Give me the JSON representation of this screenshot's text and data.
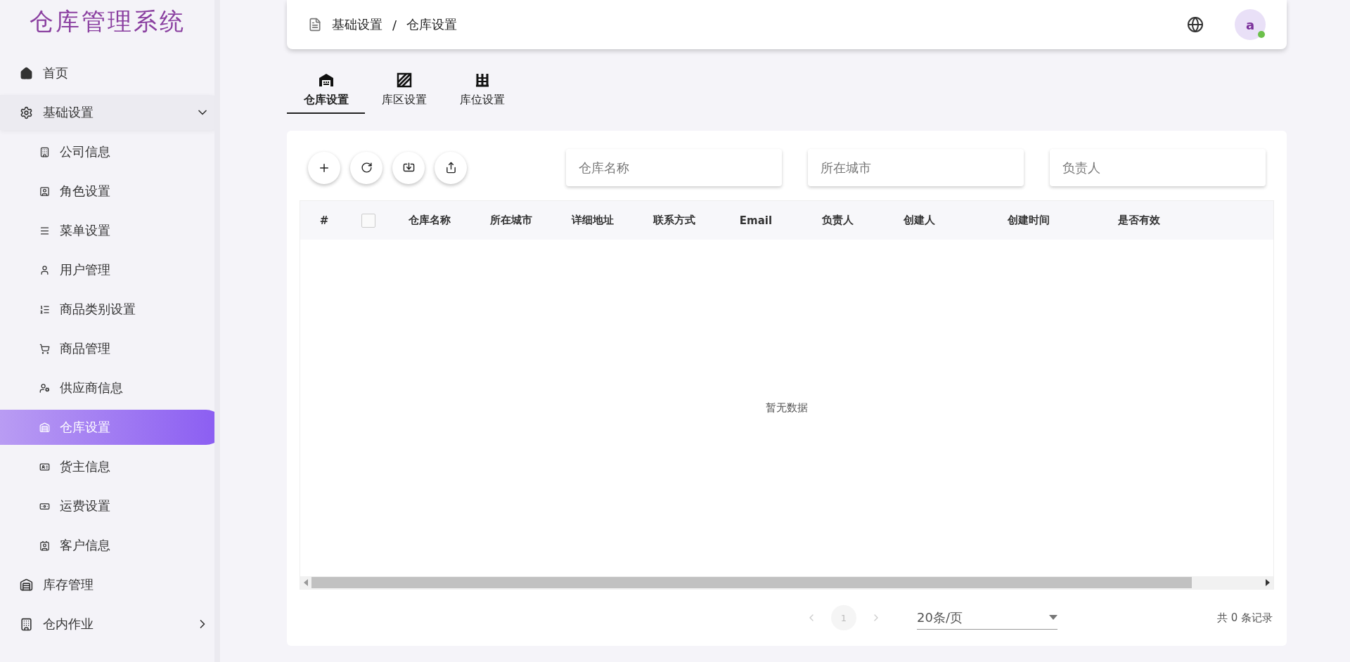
{
  "app_title": "仓库管理系统",
  "sidebar": {
    "items": [
      {
        "label": "首页",
        "selected": false
      },
      {
        "label": "基础设置",
        "expandable": true,
        "expanded": true,
        "selected": false,
        "children": [
          {
            "label": "公司信息",
            "selected": false
          },
          {
            "label": "角色设置",
            "selected": false
          },
          {
            "label": "菜单设置",
            "selected": false
          },
          {
            "label": "用户管理",
            "selected": false
          },
          {
            "label": "商品类别设置",
            "selected": false
          },
          {
            "label": "商品管理",
            "selected": false
          },
          {
            "label": "供应商信息",
            "selected": false
          },
          {
            "label": "仓库设置",
            "selected": true
          },
          {
            "label": "货主信息",
            "selected": false
          },
          {
            "label": "运费设置",
            "selected": false
          },
          {
            "label": "客户信息",
            "selected": false
          }
        ]
      },
      {
        "label": "库存管理",
        "selected": false
      },
      {
        "label": "仓内作业",
        "expandable": true,
        "expanded": false,
        "selected": false
      }
    ]
  },
  "header": {
    "breadcrumb": [
      "基础设置",
      "仓库设置"
    ],
    "separator": "/",
    "avatar": "a",
    "online": true
  },
  "tabs": [
    {
      "label": "仓库设置",
      "selected": true
    },
    {
      "label": "库区设置",
      "selected": false
    },
    {
      "label": "库位设置",
      "selected": false
    }
  ],
  "search_fields": [
    {
      "placeholder": "仓库名称"
    },
    {
      "placeholder": "所在城市"
    },
    {
      "placeholder": "负责人"
    }
  ],
  "table": {
    "select_all": {
      "checked": false
    },
    "columns": [
      "#",
      "仓库名称",
      "所在城市",
      "详细地址",
      "联系方式",
      "Email",
      "负责人",
      "创建人",
      "创建时间",
      "是否有效"
    ],
    "empty_text": "暂无数据"
  },
  "pagination": {
    "page": "1",
    "page_size": "20条/页",
    "total": "共 0 条记录"
  }
}
